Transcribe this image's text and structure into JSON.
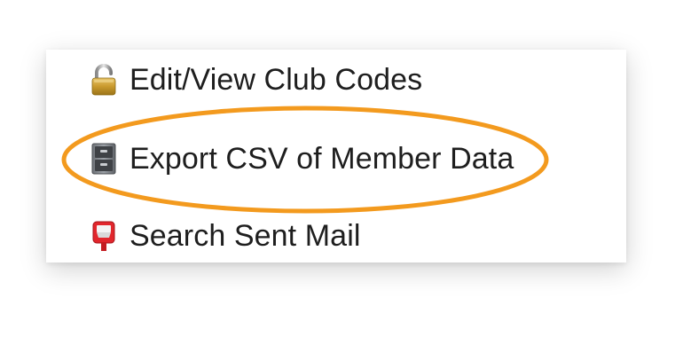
{
  "menu": {
    "items": [
      {
        "label": "Edit/View Club Codes",
        "icon": "padlock-icon"
      },
      {
        "label": "Export CSV of Member Data",
        "icon": "file-cabinet-icon"
      },
      {
        "label": "Search Sent Mail",
        "icon": "postbox-icon"
      }
    ]
  },
  "annotation": {
    "highlight_color": "#f39a1e",
    "highlighted_item": "Export CSV of Member Data"
  }
}
